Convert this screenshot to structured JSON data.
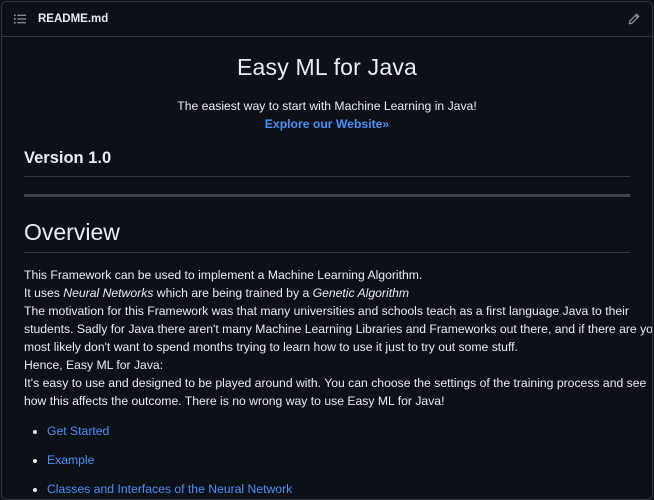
{
  "header": {
    "filename": "README.md",
    "list_icon": "list-icon",
    "edit_icon": "pencil-icon"
  },
  "readme": {
    "title": "Easy ML for Java",
    "tagline": "The easiest way to start with Machine Learning in Java!",
    "website_link": "Explore our Website»",
    "version_heading": "Version 1.0",
    "overview_heading": "Overview",
    "line1": "This Framework can be used to implement a Machine Learning Algorithm.",
    "line2_a": "It uses ",
    "line2_b": "Neural Networks",
    "line2_c": " which are being trained by a ",
    "line2_d": "Genetic Algorithm",
    "line3": "The motivation for this Framework was that many universities and schools teach as a first language Java to their",
    "line4": "students. Sadly for Java there aren't many Machine Learning Libraries and Frameworks out there, and if there are you",
    "line5": "most likely don't want to spend months trying to learn how to use it just to try out some stuff.",
    "line6": "Hence, Easy ML for Java:",
    "line7": "It's easy to use and designed to be played around with. You can choose the settings of the training process and see",
    "line8": "how this affects the outcome. There is no wrong way to use Easy ML for Java!",
    "links": [
      "Get Started",
      "Example",
      "Classes and Interfaces of the Neural Network"
    ]
  },
  "colors": {
    "background": "#0d1117",
    "text": "#e6edf3",
    "link": "#4493f8",
    "border": "#30363d"
  }
}
